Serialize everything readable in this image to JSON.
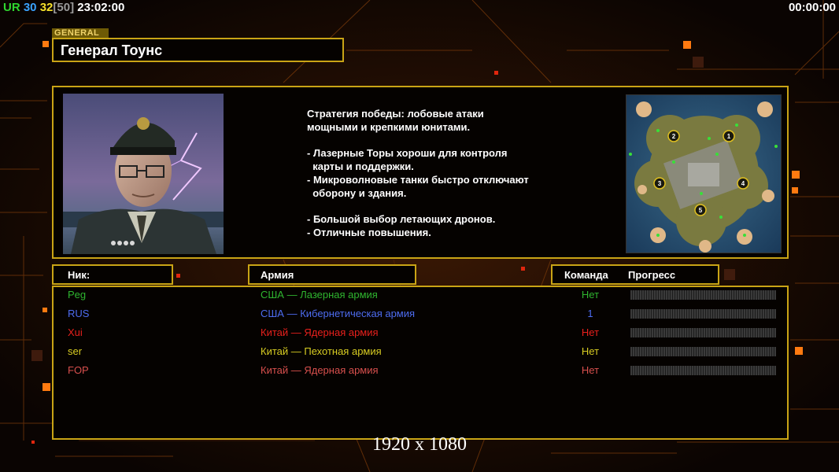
{
  "hud": {
    "ur_label": "UR",
    "value_blue": "30",
    "value_yellow": "32",
    "value_bracket": "[50]",
    "clock": "23:02:00",
    "timer": "00:00:00"
  },
  "general": {
    "tag": "GENERAL",
    "name": "Генерал Тоунс",
    "description": "Стратегия победы: лобовые атаки\nмощными и крепкими юнитами.\n\n- Лазерные Торы хороши для контроля\n  карты и поддержки.\n- Микроволновые танки быстро отключают\n  оборону и здания.\n\n- Большой выбор летающих дронов.\n- Отличные повышения."
  },
  "minimap": {
    "start_positions": [
      "1",
      "3",
      "2",
      "4",
      "5"
    ]
  },
  "lobby": {
    "headers": {
      "nick": "Ник:",
      "army": "Армия",
      "team": "Команда",
      "progress": "Прогресс"
    },
    "players": [
      {
        "nick": "Peg",
        "army": "США — Лазерная армия",
        "team": "Нет",
        "color": "#2fb52f"
      },
      {
        "nick": "RUS",
        "army": "США — Кибернетическая армия",
        "team": "1",
        "color": "#4d6cf0"
      },
      {
        "nick": "Xui",
        "army": "Китай — Ядерная армия",
        "team": "Нет",
        "color": "#e8201c"
      },
      {
        "nick": "ser",
        "army": "Китай — Пехотная армия",
        "team": "Нет",
        "color": "#d8cc22"
      },
      {
        "nick": "FOP",
        "army": "Китай — Ядерная армия",
        "team": "Нет",
        "color": "#d8504d"
      }
    ]
  },
  "resolution": "1920 x 1080",
  "colors": {
    "panel_border": "#c9a415",
    "accent_orange": "#ff7a10"
  }
}
